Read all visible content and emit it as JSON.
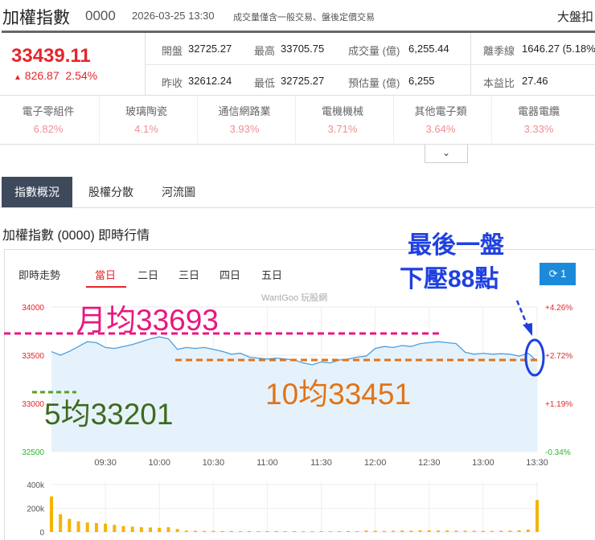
{
  "header": {
    "title": "加權指數",
    "code": "0000",
    "datetime": "2026-03-25 13:30",
    "note": "成交量僅含一般交易、盤後定價交易",
    "right_link": "大盤扣"
  },
  "quote": {
    "price": "33439.11",
    "change": "826.87",
    "change_pct": "2.54%",
    "arrow": "▲",
    "stats": [
      {
        "label": "開盤",
        "value": "32725.27"
      },
      {
        "label": "最高",
        "value": "33705.75"
      },
      {
        "label": "成交量 (億)",
        "value": "6,255.44"
      },
      {
        "label": "離季線",
        "value": "1646.27 (5.18%"
      },
      {
        "label": "昨收",
        "value": "32612.24"
      },
      {
        "label": "最低",
        "value": "32725.27"
      },
      {
        "label": "預估量 (億)",
        "value": "6,255"
      },
      {
        "label": "本益比",
        "value": "27.46"
      }
    ]
  },
  "sectors": [
    {
      "name": "電子零組件",
      "pct": "6.82%"
    },
    {
      "name": "玻璃陶瓷",
      "pct": "4.1%"
    },
    {
      "name": "通信網路業",
      "pct": "3.93%"
    },
    {
      "name": "電機機械",
      "pct": "3.71%"
    },
    {
      "name": "其他電子類",
      "pct": "3.64%"
    },
    {
      "name": "電器電纜",
      "pct": "3.33%"
    }
  ],
  "expand_icon": "chevron-down-icon",
  "tabs": [
    "指數概況",
    "股權分散",
    "河流圖"
  ],
  "section_title": "加權指數 (0000) 即時行情",
  "chart_tabs": {
    "label": "即時走勢",
    "items": [
      "當日",
      "二日",
      "三日",
      "四日",
      "五日"
    ],
    "active": 0,
    "refresh_label": "1"
  },
  "watermark": "WantGoo 玩股網",
  "annotations": {
    "monthly": "月均33693",
    "ma10": "10均33451",
    "ma5": "5均33201",
    "note_line1": "最後一盤",
    "note_line2": "下壓88點"
  },
  "colors": {
    "up": "#e5262b",
    "line": "#4a9fe0",
    "volume": "#f5b301",
    "pink": "#e8177f",
    "orange": "#e07418",
    "green": "#3d6b1f",
    "blue": "#1f40e0"
  },
  "chart_data": {
    "type": "line",
    "xlabel": "",
    "ylabel": "",
    "x_ticks": [
      "09:30",
      "10:00",
      "10:30",
      "11:00",
      "11:30",
      "12:00",
      "12:30",
      "13:00",
      "13:30"
    ],
    "y_ticks": [
      "34000",
      "33500",
      "33000",
      "32500"
    ],
    "y_right_ticks": [
      "+4.26%",
      "+2.72%",
      "+1.19%",
      "-0.34%"
    ],
    "ylim": [
      32500,
      34000
    ],
    "prev_close": 32612.24,
    "series": [
      {
        "name": "加權指數",
        "interval_min": 5,
        "start": "09:00",
        "values": [
          33537,
          33500,
          33540,
          33590,
          33640,
          33630,
          33580,
          33570,
          33590,
          33610,
          33640,
          33670,
          33690,
          33670,
          33560,
          33580,
          33570,
          33580,
          33560,
          33540,
          33510,
          33520,
          33480,
          33470,
          33460,
          33470,
          33460,
          33450,
          33420,
          33400,
          33430,
          33420,
          33450,
          33460,
          33480,
          33490,
          33570,
          33590,
          33580,
          33600,
          33590,
          33620,
          33630,
          33640,
          33630,
          33620,
          33530,
          33510,
          33520,
          33510,
          33515,
          33510,
          33490,
          33520,
          33439
        ]
      }
    ],
    "volume": {
      "y_ticks": [
        "400k",
        "200k",
        "0"
      ],
      "ylim": [
        0,
        400000
      ],
      "values": [
        300000,
        150000,
        110000,
        90000,
        80000,
        75000,
        70000,
        60000,
        50000,
        45000,
        40000,
        38000,
        35000,
        40000,
        25000,
        12000,
        10000,
        9000,
        9000,
        8000,
        8000,
        7000,
        8000,
        7000,
        7000,
        8000,
        7000,
        7000,
        6000,
        6000,
        7000,
        6000,
        7000,
        8000,
        7000,
        12000,
        10000,
        9000,
        10000,
        12000,
        11000,
        13000,
        14000,
        12000,
        12000,
        11000,
        10000,
        10000,
        9000,
        9000,
        10000,
        11000,
        14000,
        20000,
        270000
      ]
    }
  }
}
